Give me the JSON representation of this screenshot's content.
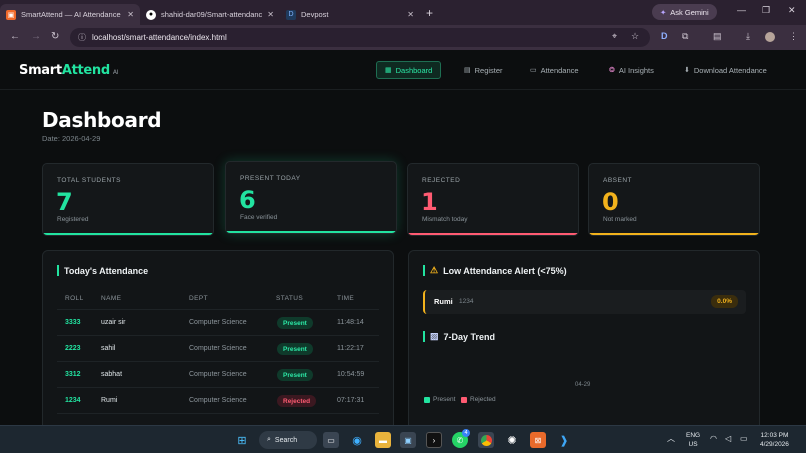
{
  "browser": {
    "tabs": [
      {
        "title": "SmartAttend — AI Attendance",
        "icon": "smartattend-favicon",
        "active": true
      },
      {
        "title": "shahid-dar09/Smart-attendance",
        "icon": "github-favicon",
        "active": false
      },
      {
        "title": "Devpost",
        "icon": "devpost-favicon",
        "active": false
      }
    ],
    "gemini_label": "Ask Gemini",
    "url": "localhost/smart-attendance/index.html"
  },
  "app": {
    "logo_main": "Smart",
    "logo_accent": "Attend",
    "logo_suffix": "AI",
    "nav": [
      {
        "label": "Dashboard",
        "icon": "chart-icon",
        "active": true
      },
      {
        "label": "Register",
        "icon": "document-icon",
        "active": false
      },
      {
        "label": "Attendance",
        "icon": "table-icon",
        "active": false
      },
      {
        "label": "AI Insights",
        "icon": "brain-icon",
        "active": false
      },
      {
        "label": "Download Attendance",
        "icon": "download-icon",
        "active": false
      }
    ]
  },
  "dashboard": {
    "title": "Dashboard",
    "date": "Date: 2026-04-29",
    "stats": [
      {
        "label": "TOTAL STUDENTS",
        "value": "7",
        "sub": "Registered",
        "color": "#22e3a0"
      },
      {
        "label": "PRESENT TODAY",
        "value": "6",
        "sub": "Face verified",
        "color": "#22e3a0"
      },
      {
        "label": "REJECTED",
        "value": "1",
        "sub": "Mismatch today",
        "color": "#ff5b72"
      },
      {
        "label": "ABSENT",
        "value": "0",
        "sub": "Not marked",
        "color": "#f2b21c"
      }
    ]
  },
  "attendance": {
    "title": "Today's Attendance",
    "columns": [
      "ROLL",
      "NAME",
      "DEPT",
      "STATUS",
      "TIME"
    ],
    "rows": [
      {
        "roll": "3333",
        "name": "uzair sir",
        "dept": "Computer Science",
        "status": "Present",
        "time": "11:48:14"
      },
      {
        "roll": "2223",
        "name": "sahil",
        "dept": "Computer Science",
        "status": "Present",
        "time": "11:22:17"
      },
      {
        "roll": "3312",
        "name": "sabhat",
        "dept": "Computer Science",
        "status": "Present",
        "time": "10:54:59"
      },
      {
        "roll": "1234",
        "name": "Rumi",
        "dept": "Computer Science",
        "status": "Rejected",
        "time": "07:17:31"
      }
    ]
  },
  "alerts": {
    "title": "Low Attendance Alert (<75%)",
    "title_icon": "warning-icon",
    "items": [
      {
        "name": "Rumi",
        "roll": "1234",
        "percent": "0.0%"
      }
    ]
  },
  "trend": {
    "title": "7-Day Trend",
    "title_icon": "chart-icon",
    "x_label": "04-29",
    "legend": [
      "Present",
      "Rejected"
    ],
    "colors": {
      "present": "#22e3a0",
      "rejected": "#ff5b72"
    }
  },
  "taskbar": {
    "search_label": "Search",
    "whatsapp_badge": "4",
    "lang_top": "ENG",
    "lang_bottom": "US",
    "time": "12:03 PM",
    "date": "4/29/2026"
  }
}
